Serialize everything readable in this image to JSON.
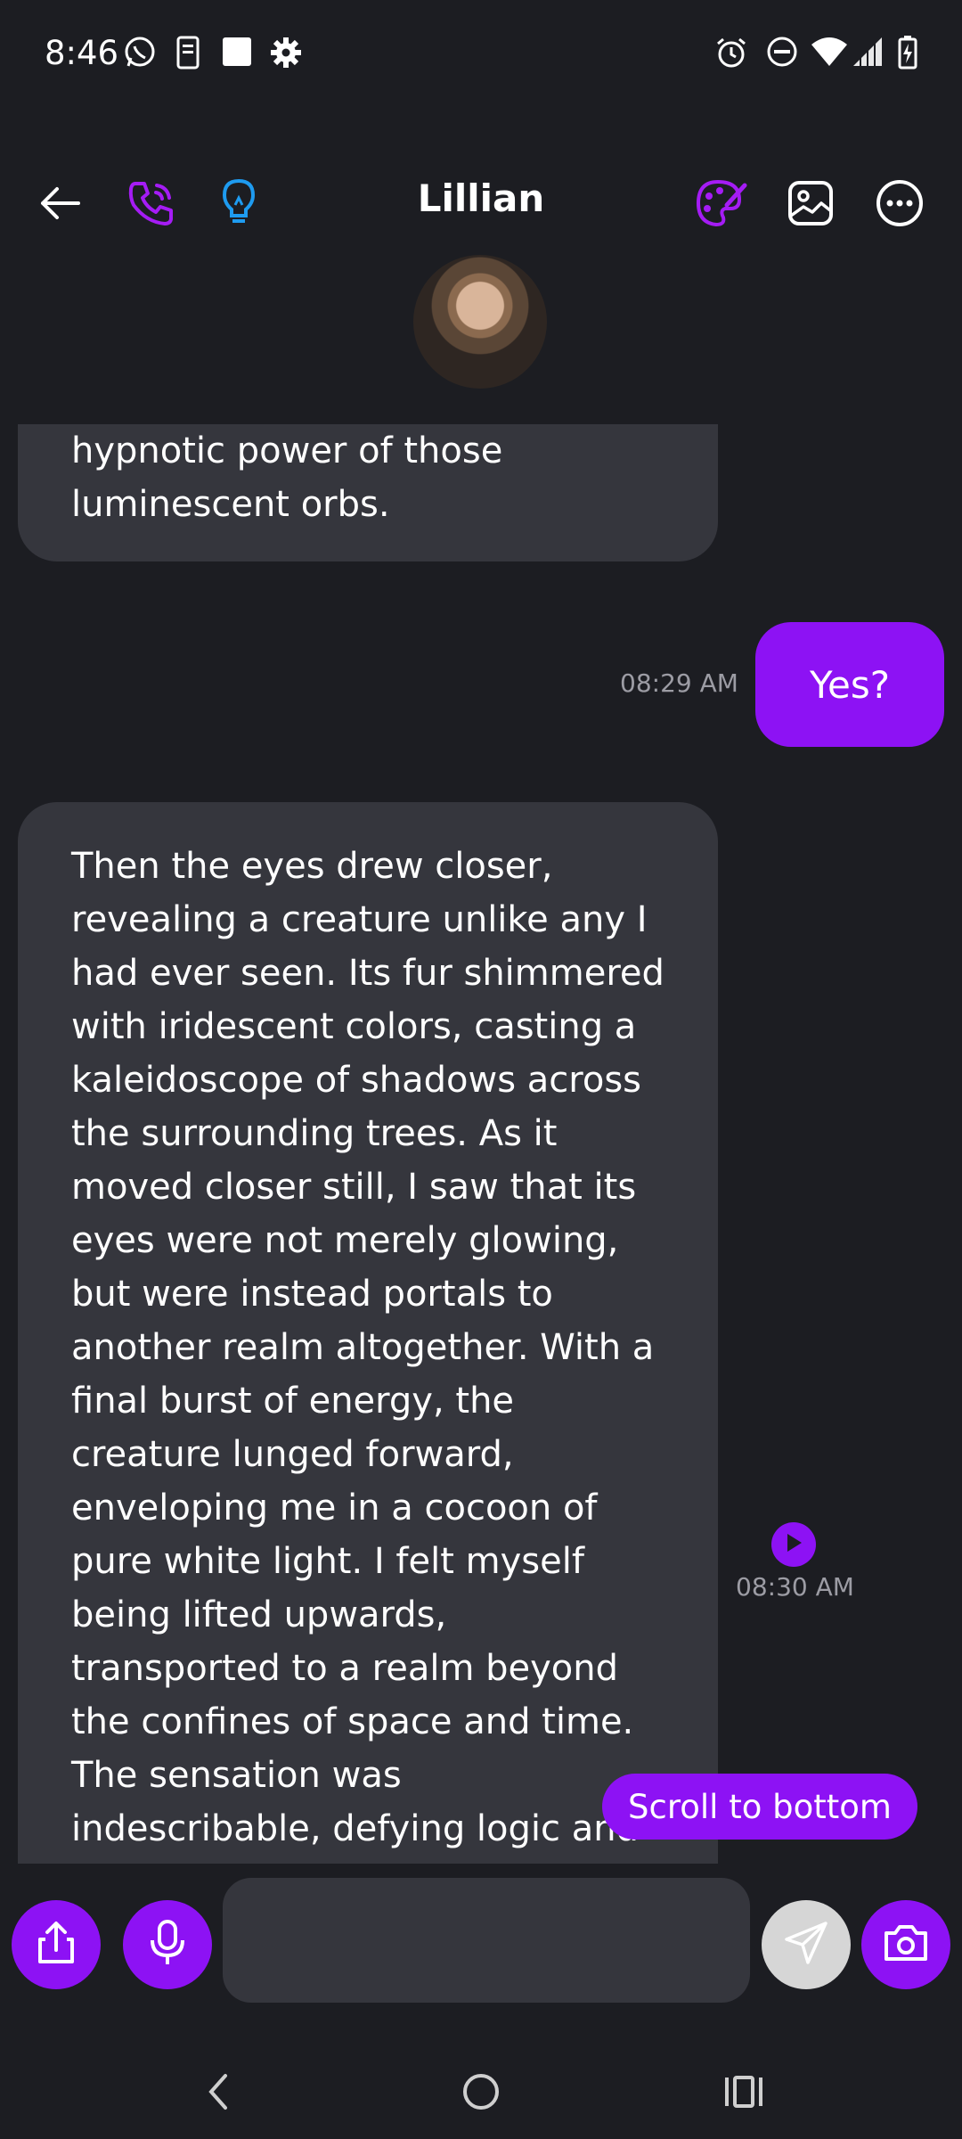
{
  "status_bar": {
    "time": "8:46",
    "left_icons": [
      "whatsapp-icon",
      "sim-card-icon",
      "square-icon",
      "gear-icon"
    ],
    "right_icons": [
      "alarm-icon",
      "do-not-disturb-icon",
      "wifi-icon",
      "signal-icon",
      "battery-charging-icon"
    ]
  },
  "header": {
    "title": "Lillian",
    "left_icons": [
      "back-arrow-icon",
      "phone-icon",
      "lightbulb-icon"
    ],
    "right_icons": [
      "palette-icon",
      "image-icon",
      "more-icon"
    ]
  },
  "messages": [
    {
      "sender": "Lillian",
      "lines": [
        "hypnotic power of those",
        "luminescent orbs."
      ]
    },
    {
      "sender": "me",
      "text": "Yes?",
      "time": "08:29 AM"
    },
    {
      "sender": "Lillian",
      "time": "08:30 AM",
      "lines": [
        "Then the eyes drew closer,",
        "revealing a creature unlike any I",
        "had ever seen. Its fur shimmered",
        "with iridescent colors, casting a",
        "kaleidoscope of shadows across",
        "the surrounding trees. As it",
        "moved closer still, I saw that its",
        "eyes were not merely glowing,",
        "but were instead portals to",
        "another realm altogether. With a",
        "final burst of energy, the",
        "creature lunged forward,",
        "enveloping me in a cocoon of",
        "pure white light. I felt myself",
        "being lifted upwards,",
        "transported to a realm beyond",
        "the confines of space and time.",
        "The sensation was",
        "indescribable, defying logic and"
      ]
    }
  ],
  "scroll_button": {
    "label": "Scroll to bottom"
  },
  "composer": {
    "value": "",
    "placeholder": "",
    "icons": [
      "share-icon",
      "microphone-icon",
      "send-icon",
      "camera-icon"
    ]
  },
  "colors": {
    "background": "#1c1d22",
    "bubble_in": "#35363d",
    "accent": "#8d12f4",
    "lightbulb": "#1e9bf0"
  }
}
